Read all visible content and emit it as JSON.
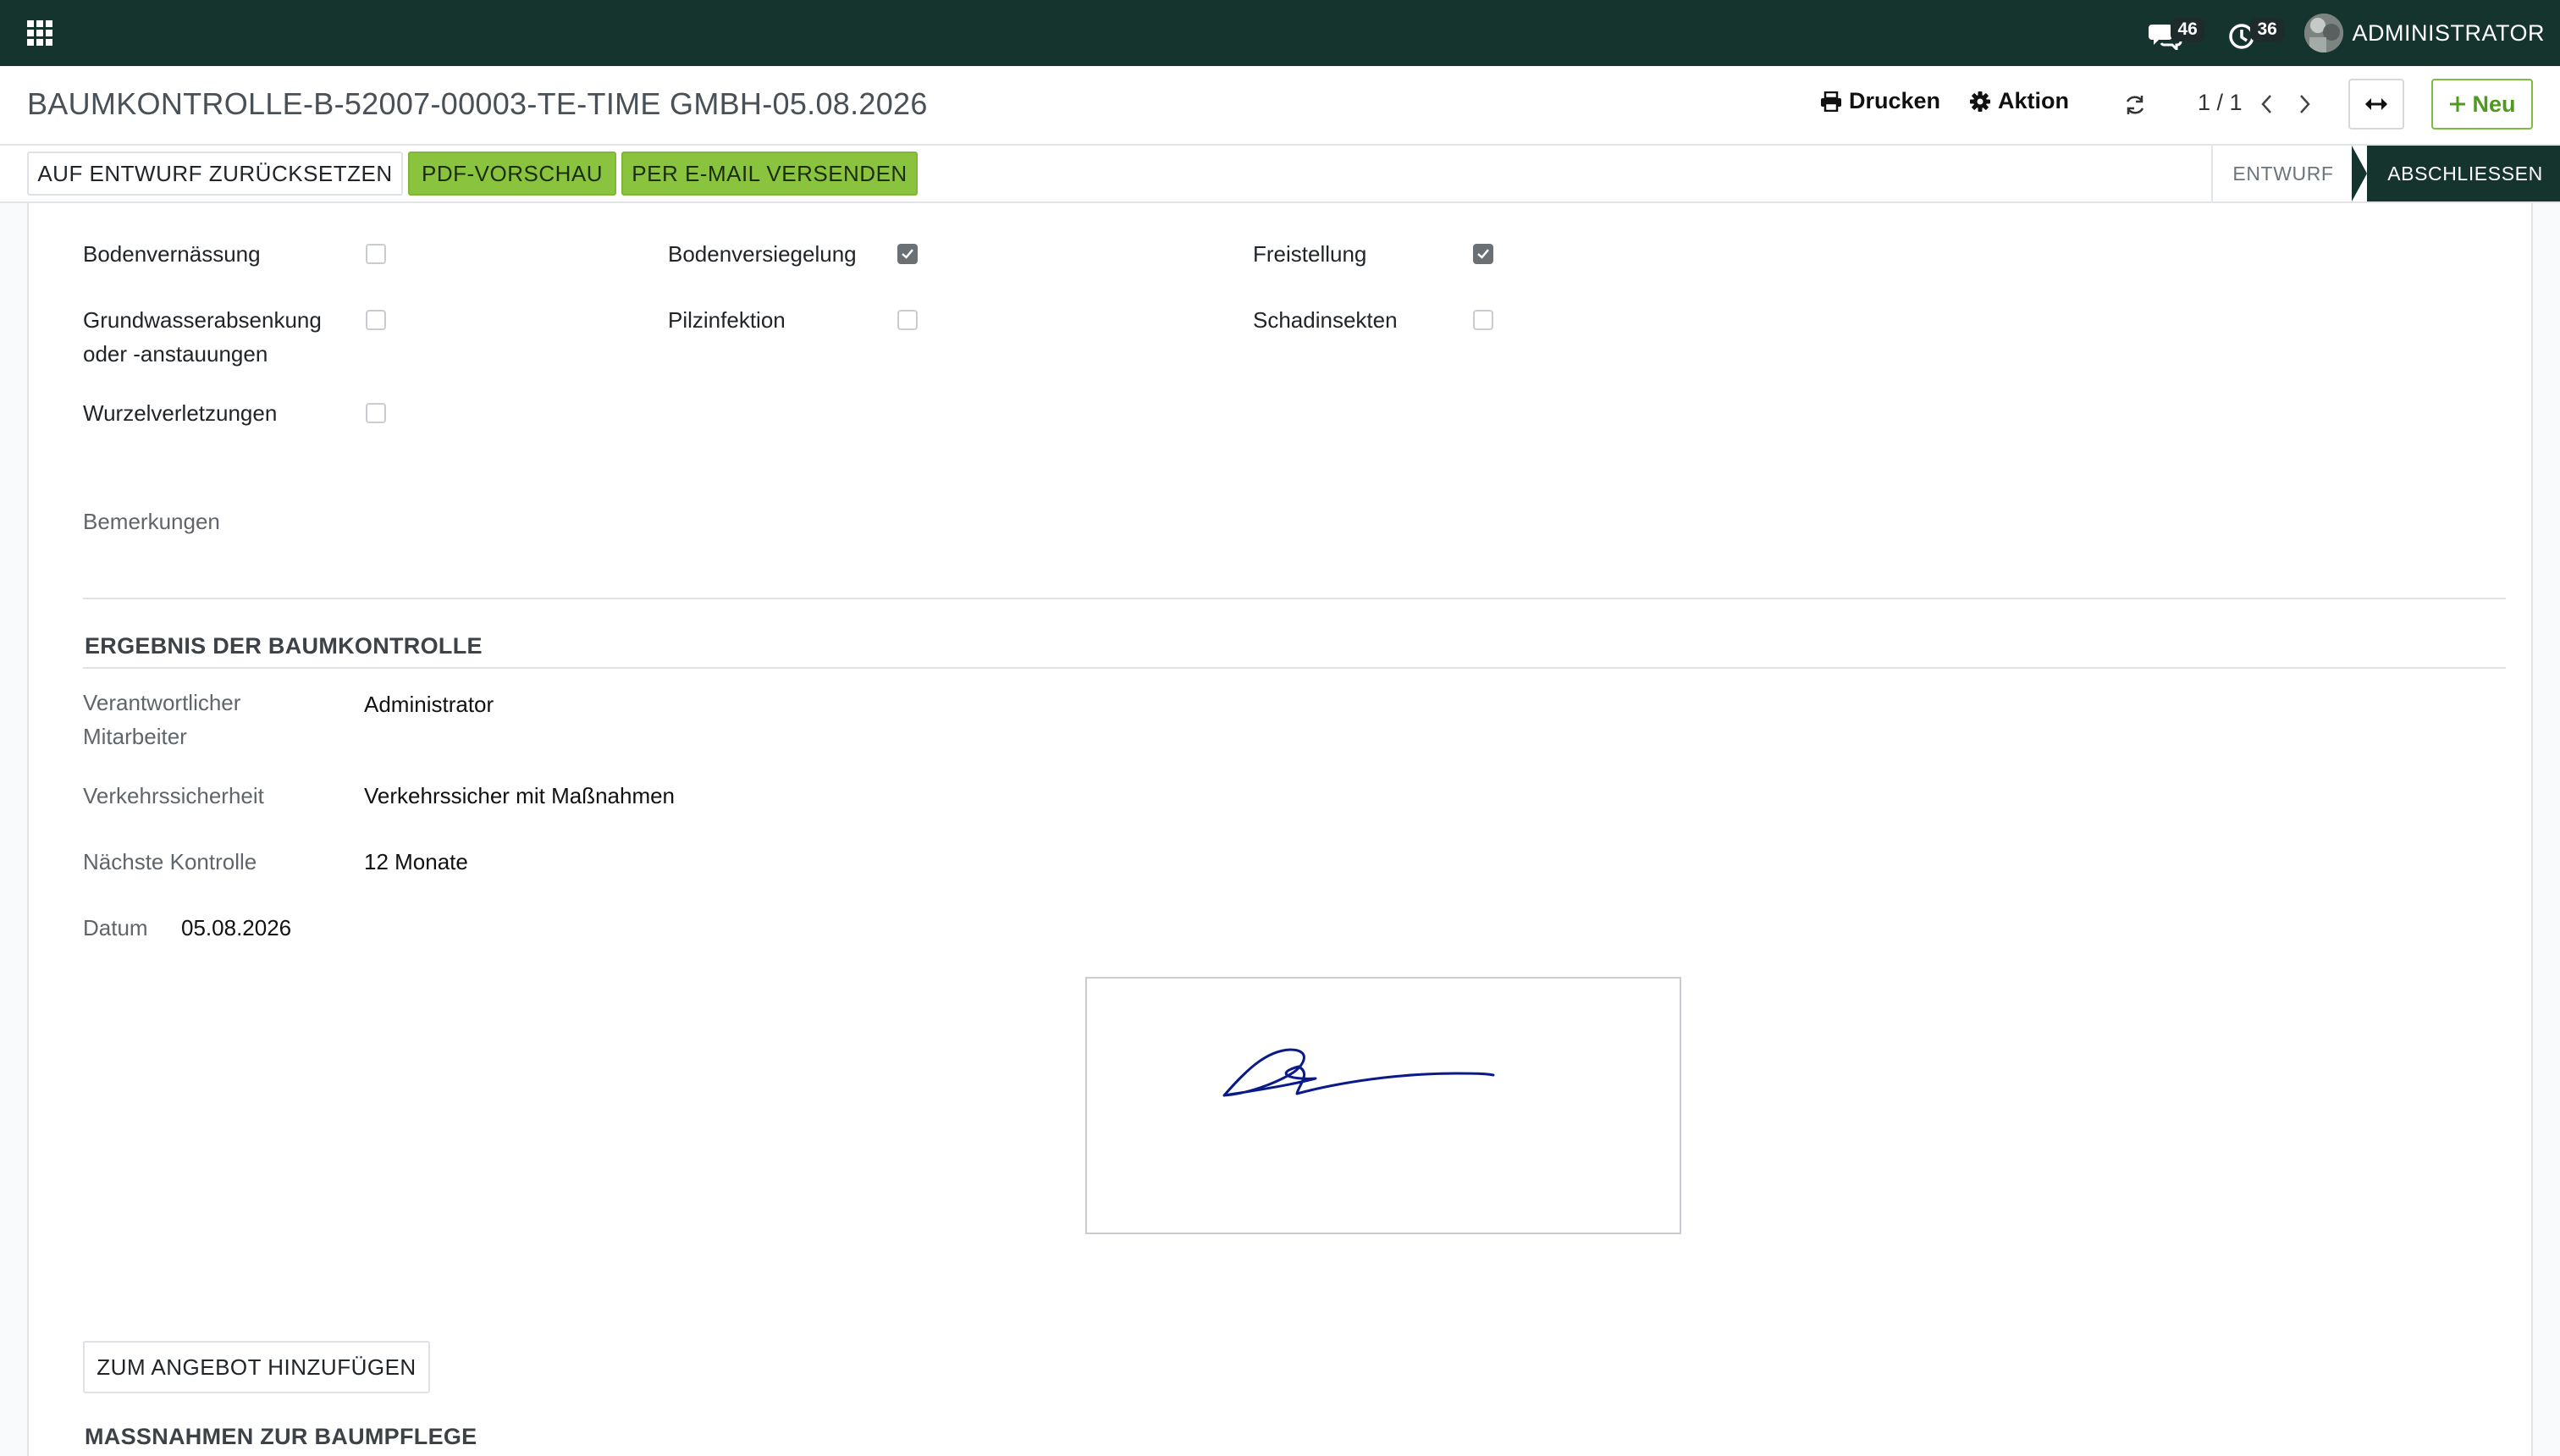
{
  "navbar": {
    "messages_count": "46",
    "activities_count": "36",
    "user_name": "ADMINISTRATOR",
    "bg_color": "#16342e"
  },
  "control_panel": {
    "breadcrumb": "BAUMKONTROLLE-B-52007-00003-TE-TIME GMBH-05.08.2026",
    "print_label": "Drucken",
    "action_label": "Aktion",
    "pager": "1 / 1",
    "new_label": "Neu"
  },
  "statusbar": {
    "reset_label": "AUF ENTWURF ZURÜCKSETZEN",
    "pdf_label": "PDF-VORSCHAU",
    "email_label": "PER E-MAIL VERSENDEN",
    "stages": [
      "ENTWURF",
      "ABSCHLIESSEN"
    ],
    "active_stage": "ABSCHLIESSEN",
    "primary_color": "#8ac43f"
  },
  "checks": {
    "bodenvernaessung": {
      "label": "Bodenvernässung",
      "checked": false
    },
    "bodenversiegelung": {
      "label": "Bodenversiegelung",
      "checked": true
    },
    "freistellung": {
      "label": "Freistellung",
      "checked": true
    },
    "grundwasser": {
      "label": "Grundwasserabsenkung oder -anstauungen",
      "line1": "Grundwasserabsenkung",
      "line2": "oder -anstauungen",
      "checked": false
    },
    "pilzinfektion": {
      "label": "Pilzinfektion",
      "checked": false
    },
    "schadinsekten": {
      "label": "Schadinsekten",
      "checked": false
    },
    "wurzelverletzungen": {
      "label": "Wurzelverletzungen",
      "checked": false
    }
  },
  "remarks_label": "Bemerkungen",
  "result": {
    "title": "ERGEBNIS DER BAUMKONTROLLE",
    "employee_label_1": "Verantwortlicher",
    "employee_label_2": "Mitarbeiter",
    "employee_value": "Administrator",
    "safety_label": "Verkehrssicherheit",
    "safety_value": "Verkehrssicher mit Maßnahmen",
    "next_label": "Nächste Kontrolle",
    "next_value": "12 Monate",
    "date_label": "Datum",
    "date_value": "05.08.2026"
  },
  "add_offer_label": "ZUM ANGEBOT HINZUFÜGEN",
  "measures_title": "MASSNAHMEN ZUR BAUMPFLEGE"
}
